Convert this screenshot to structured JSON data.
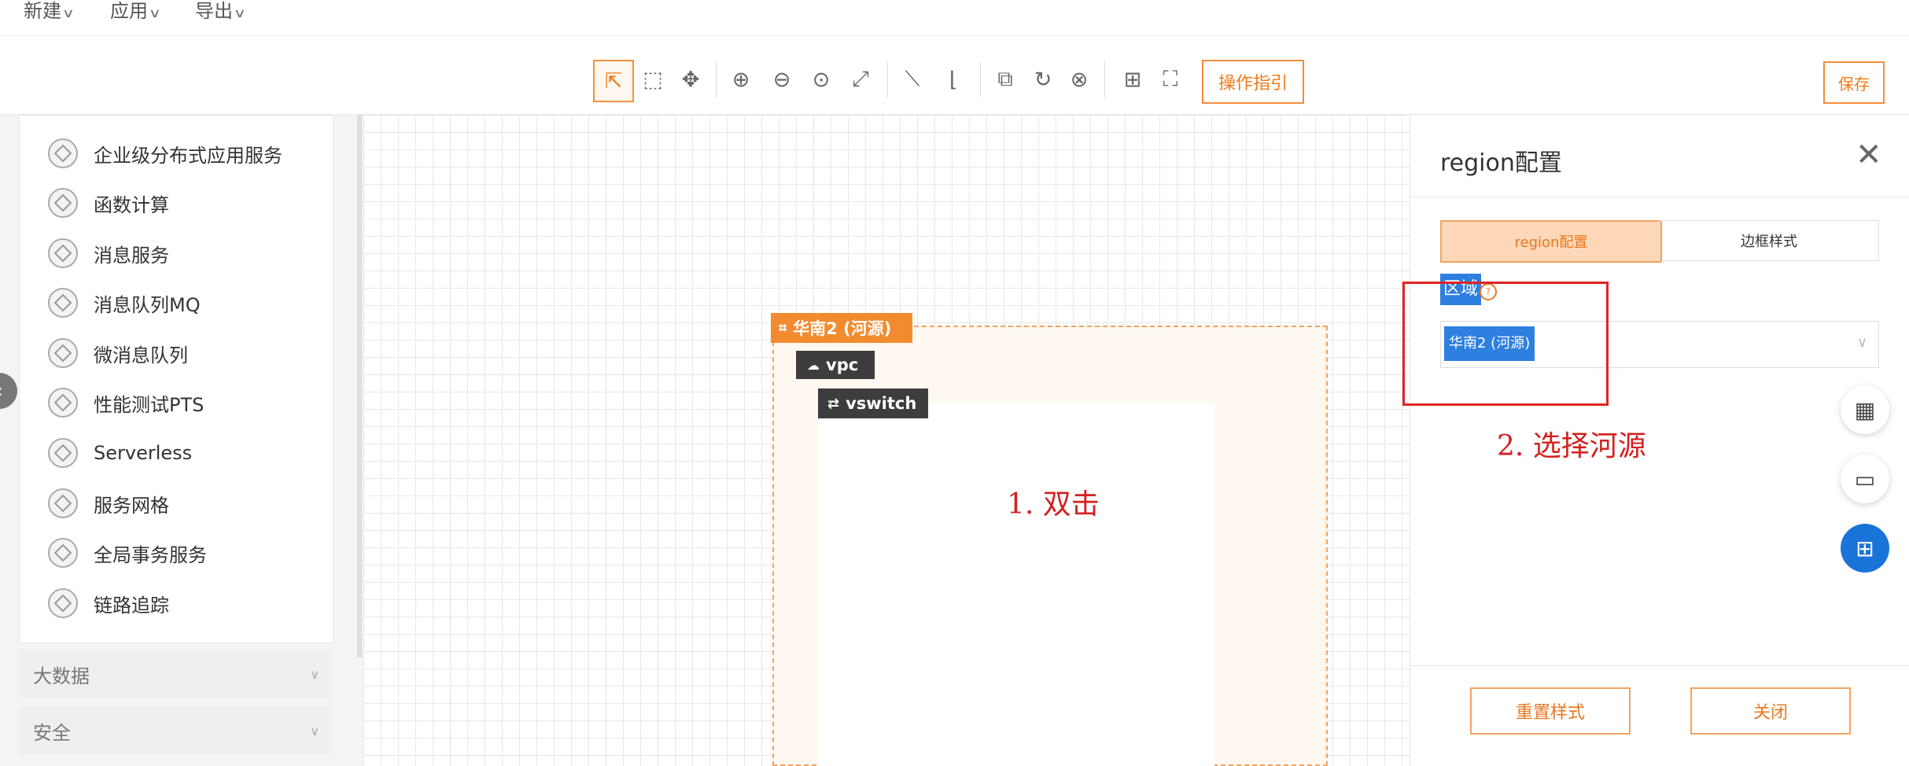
{
  "menubar": {
    "items": [
      "新建",
      "应用",
      "导出"
    ]
  },
  "toolbar": {
    "guide_label": "操作指引",
    "save_label": "保存",
    "tools": [
      {
        "name": "select-tool-icon",
        "glyph": "⇱"
      },
      {
        "name": "marquee-select-tool-icon",
        "glyph": "⬚"
      },
      {
        "name": "pan-tool-icon",
        "glyph": "✥"
      },
      {
        "name": "zoom-in-icon",
        "glyph": "⊕"
      },
      {
        "name": "zoom-out-icon",
        "glyph": "⊖"
      },
      {
        "name": "zoom-reset-icon",
        "glyph": "⊙"
      },
      {
        "name": "fit-view-icon",
        "glyph": "⤢"
      },
      {
        "name": "straight-connector-icon",
        "glyph": "⟍"
      },
      {
        "name": "elbow-connector-icon",
        "glyph": "⌊"
      },
      {
        "name": "copy-icon",
        "glyph": "⧉"
      },
      {
        "name": "rotate-icon",
        "glyph": "↻"
      },
      {
        "name": "delete-icon",
        "glyph": "⊗"
      },
      {
        "name": "grid-icon",
        "glyph": "⊞"
      },
      {
        "name": "fullscreen-icon",
        "glyph": "⛶"
      }
    ]
  },
  "sidebar": {
    "items": [
      "企业级分布式应用服务",
      "函数计算",
      "消息服务",
      "消息队列MQ",
      "微消息队列",
      "性能测试PTS",
      "Serverless",
      "服务网格",
      "全局事务服务",
      "链路追踪"
    ],
    "groups": [
      "大数据",
      "安全"
    ]
  },
  "diagram": {
    "region_label": "华南2 (河源)",
    "vpc_label": "vpc",
    "vswitch_label": "vswitch"
  },
  "annotations": {
    "step1": "1. 双击",
    "step2": "2. 选择河源"
  },
  "panel": {
    "title": "region配置",
    "tabs": [
      "region配置",
      "边框样式"
    ],
    "field_label": "区域",
    "field_value": "华南2 (河源)",
    "reset_label": "重置样式",
    "close_label": "关闭"
  },
  "colors": {
    "accent": "#f07b1b",
    "selection_blue": "#2d7fe0",
    "annotation_red": "#d42020"
  }
}
